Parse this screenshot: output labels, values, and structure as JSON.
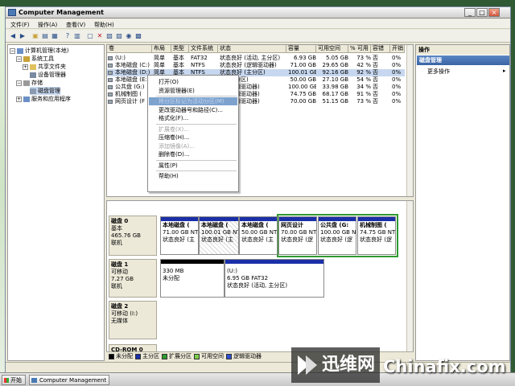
{
  "window": {
    "title": "Computer Management"
  },
  "menu": [
    "文件(F)",
    "操作(A)",
    "查看(V)",
    "帮助(H)"
  ],
  "tree": [
    {
      "label": "计算机管理(本地)",
      "indent": 0,
      "exp": "-"
    },
    {
      "label": "系统工具",
      "indent": 1,
      "exp": "-"
    },
    {
      "label": "共享文件夹",
      "indent": 2,
      "exp": "+"
    },
    {
      "label": "设备管理器",
      "indent": 2,
      "exp": ""
    },
    {
      "label": "存储",
      "indent": 1,
      "exp": "-"
    },
    {
      "label": "磁盘管理",
      "indent": 2,
      "exp": "",
      "selected": true
    },
    {
      "label": "服务和应用程序",
      "indent": 1,
      "exp": "+"
    }
  ],
  "volume_table": {
    "headers": [
      "卷",
      "布局",
      "类型",
      "文件系统",
      "状态",
      "容量",
      "可用空间",
      "% 可用",
      "容错",
      "开销"
    ],
    "rows": [
      [
        "(U:)",
        "简单",
        "基本",
        "FAT32",
        "状态良好 (活动, 主分区)",
        "6.93 GB",
        "5.05 GB",
        "73 %",
        "否",
        "0%"
      ],
      [
        "本地磁盘 (C:)",
        "简单",
        "基本",
        "NTFS",
        "状态良好 (逻辑驱动器)",
        "71.00 GB",
        "29.65 GB",
        "42 %",
        "否",
        "0%"
      ],
      [
        "本地磁盘 (D:)",
        "简单",
        "基本",
        "NTFS",
        "状态良好 (主分区)",
        "100.01 GB",
        "92.16 GB",
        "92 %",
        "否",
        "0%"
      ],
      [
        "本地磁盘 (E:)",
        "",
        "",
        "",
        "好 (主分区)",
        "50.00 GB",
        "27.10 GB",
        "54 %",
        "否",
        "0%"
      ],
      [
        "公共盘 (G:)",
        "",
        "",
        "",
        "好 (逻辑驱动器)",
        "100.00 GB",
        "33.98 GB",
        "34 %",
        "否",
        "0%"
      ],
      [
        "机械制图 (",
        "",
        "",
        "",
        "好 (逻辑驱动器)",
        "74.75 GB",
        "68.17 GB",
        "91 %",
        "否",
        "0%"
      ],
      [
        "网页设计 (F",
        "",
        "",
        "",
        "好 (逻辑驱动器)",
        "70.00 GB",
        "51.15 GB",
        "73 %",
        "否",
        "0%"
      ]
    ]
  },
  "context_menu": [
    {
      "label": "打开(O)",
      "disabled": false
    },
    {
      "label": "资源管理器(E)",
      "disabled": false
    },
    {
      "sep": true
    },
    {
      "label": "将分区标记为活动分区(M)",
      "disabled": false,
      "highlighted": true
    },
    {
      "label": "更改驱动器号和路径(C)...",
      "disabled": false
    },
    {
      "label": "格式化(F)...",
      "disabled": false
    },
    {
      "sep": true
    },
    {
      "label": "扩展卷(X)...",
      "disabled": true
    },
    {
      "label": "压缩卷(H)...",
      "disabled": false
    },
    {
      "label": "添加镜像(A)...",
      "disabled": true
    },
    {
      "label": "删除卷(D)...",
      "disabled": false
    },
    {
      "sep": true
    },
    {
      "label": "属性(P)",
      "disabled": false
    },
    {
      "sep": true
    },
    {
      "label": "帮助(H)",
      "disabled": false
    }
  ],
  "disks": [
    {
      "name": "磁盘 0",
      "type": "基本",
      "size": "465.76 GB",
      "status": "联机",
      "partitions": [
        {
          "name": "本地磁盘 (",
          "size": "71.00 GB NTF",
          "status": "状态良好 (主",
          "bar": "#1a2fa8"
        },
        {
          "name": "本地磁盘 (",
          "size": "100.01 GB NT",
          "status": "状态良好 (主",
          "bar": "#1a2fa8",
          "hatch": true
        },
        {
          "name": "本地磁盘 (",
          "size": "50.00 GB NTF",
          "status": "状态良好 (主",
          "bar": "#1a2fa8"
        },
        {
          "name": "网页设计",
          "size": "70.00 GB NT",
          "status": "状态良好 (逻",
          "bar": "#1a2fa8",
          "extended": true
        },
        {
          "name": "公共盘 (G:",
          "size": "100.00 GB NT",
          "status": "状态良好 (逻",
          "bar": "#1a2fa8",
          "extended": true
        },
        {
          "name": "机械制图 (",
          "size": "74.75 GB NTF",
          "status": "状态良好 (逻",
          "bar": "#1a2fa8",
          "extended": true
        }
      ]
    },
    {
      "name": "磁盘 1",
      "type": "可移动",
      "size": "7.27 GB",
      "status": "联机",
      "partitions": [
        {
          "name": "",
          "size": "330 MB",
          "status": "未分配",
          "bar": "#000000"
        },
        {
          "name": "(U:)",
          "size": "6.95 GB FAT32",
          "status": "状态良好 (活动, 主分区)",
          "bar": "#1a2fa8"
        }
      ]
    },
    {
      "name": "磁盘 2",
      "type": "可移动 (I:)",
      "size": "",
      "status": "无媒体",
      "partitions": []
    },
    {
      "name": "CD-ROM 0",
      "type": "",
      "size": "",
      "status": "",
      "partitions": []
    }
  ],
  "legend": [
    {
      "label": "未分配",
      "color": "#000000"
    },
    {
      "label": "主分区",
      "color": "#1a2fa8"
    },
    {
      "label": "扩展分区",
      "color": "#2e9a2e"
    },
    {
      "label": "可用空间",
      "color": "#7ccf4a"
    },
    {
      "label": "逻辑驱动器",
      "color": "#3050d0"
    }
  ],
  "actions": {
    "header": "操作",
    "group": "磁盘管理",
    "more": "更多操作"
  },
  "taskbar": {
    "start": "开始",
    "task": "Computer Management"
  },
  "watermark": {
    "left": "迅维网",
    "right": "Chinafix.com"
  }
}
